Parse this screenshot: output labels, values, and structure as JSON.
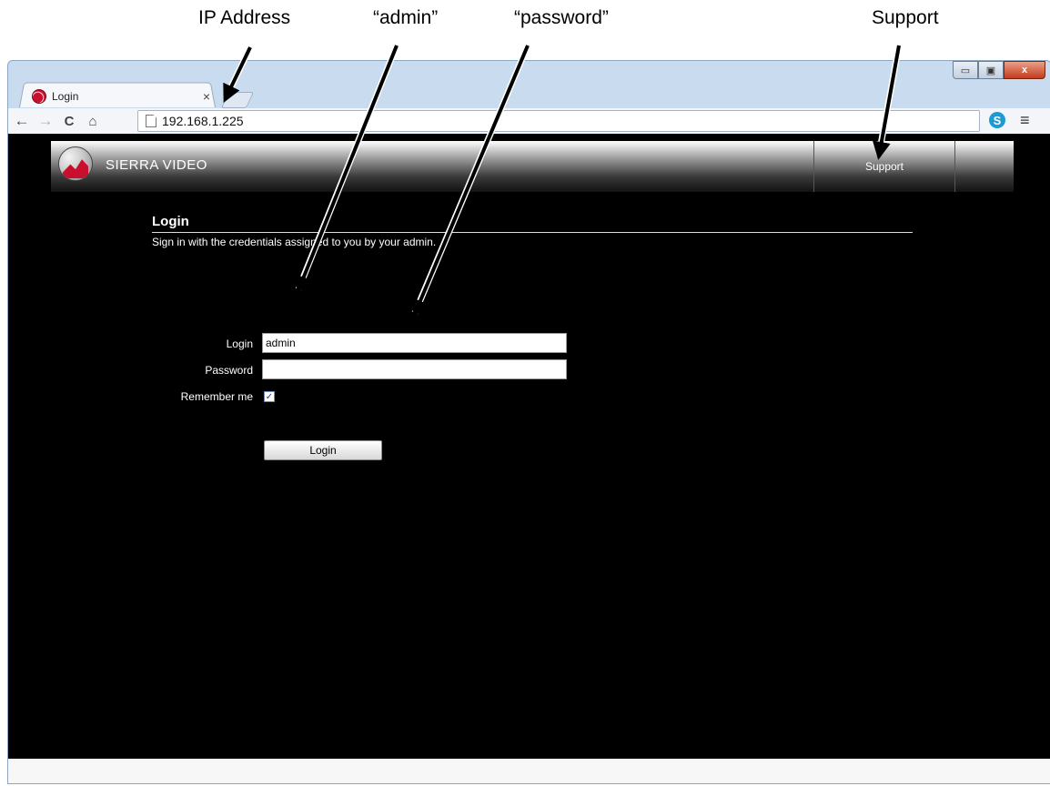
{
  "annotations": {
    "ip_address": "IP Address",
    "admin": "“admin”",
    "password": "“password”",
    "support": "Support"
  },
  "browser": {
    "tab_title": "Login",
    "tab_close": "×",
    "url": "192.168.1.225",
    "window_controls": {
      "minimize": "▭",
      "maximize": "▣",
      "close": "x"
    },
    "skype_label": "S",
    "menu_icon": "≡"
  },
  "site": {
    "brand": "SIERRA VIDEO",
    "support_link": "Support"
  },
  "login": {
    "title": "Login",
    "subtitle": "Sign in with the credentials assigned to you by your admin.",
    "login_label": "Login",
    "login_value": "admin",
    "password_label": "Password",
    "password_value": "",
    "remember_label": "Remember me",
    "remember_checked": true,
    "remember_mark": "✓",
    "button_label": "Login"
  },
  "colors": {
    "brand_red": "#c8102e",
    "page_background": "#000000"
  }
}
